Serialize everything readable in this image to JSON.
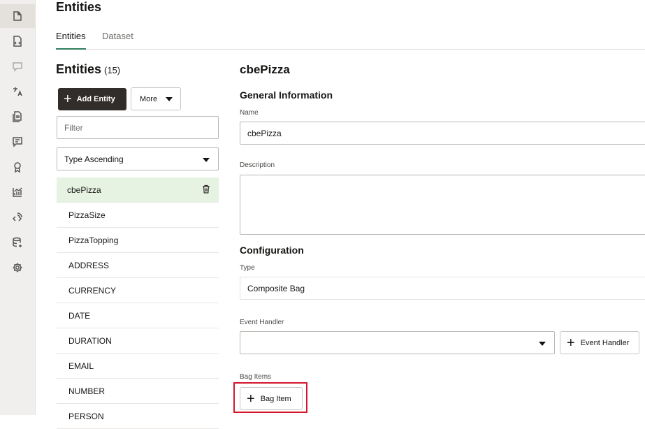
{
  "rail": {
    "items": [
      {
        "name": "entities-icon",
        "active": true
      },
      {
        "name": "intents-icon",
        "active": false
      },
      {
        "name": "chat-icon",
        "active": false
      },
      {
        "name": "translate-icon",
        "active": false
      },
      {
        "name": "document-icon",
        "active": false
      },
      {
        "name": "conversation-icon",
        "active": false
      },
      {
        "name": "badge-icon",
        "active": false
      },
      {
        "name": "insights-icon",
        "active": false
      },
      {
        "name": "channels-icon",
        "active": false
      },
      {
        "name": "data-icon",
        "active": false
      },
      {
        "name": "settings-icon",
        "active": false
      }
    ]
  },
  "page": {
    "title": "Entities"
  },
  "tabs": [
    {
      "label": "Entities",
      "active": true
    },
    {
      "label": "Dataset",
      "active": false
    }
  ],
  "list": {
    "title": "Entities",
    "count": "(15)",
    "add_label": "Add Entity",
    "more_label": "More",
    "filter_placeholder": "Filter",
    "sort_value": "Type Ascending",
    "items": [
      "cbePizza",
      "PizzaSize",
      "PizzaTopping",
      "ADDRESS",
      "CURRENCY",
      "DATE",
      "DURATION",
      "EMAIL",
      "NUMBER",
      "PERSON"
    ]
  },
  "detail": {
    "title": "cbePizza",
    "general_heading": "General Information",
    "name_label": "Name",
    "name_value": "cbePizza",
    "description_label": "Description",
    "description_value": "",
    "config_heading": "Configuration",
    "type_label": "Type",
    "type_value": "Composite Bag",
    "event_handler_label": "Event Handler",
    "event_handler_value": "",
    "event_handler_button": "Event Handler",
    "bag_items_label": "Bag Items",
    "bag_item_button": "Bag Item"
  },
  "colors": {
    "accent": "#2e7d5b",
    "highlight": "#d5172e",
    "dark_button": "#312d2a",
    "selected_row": "#e6f2e2"
  }
}
